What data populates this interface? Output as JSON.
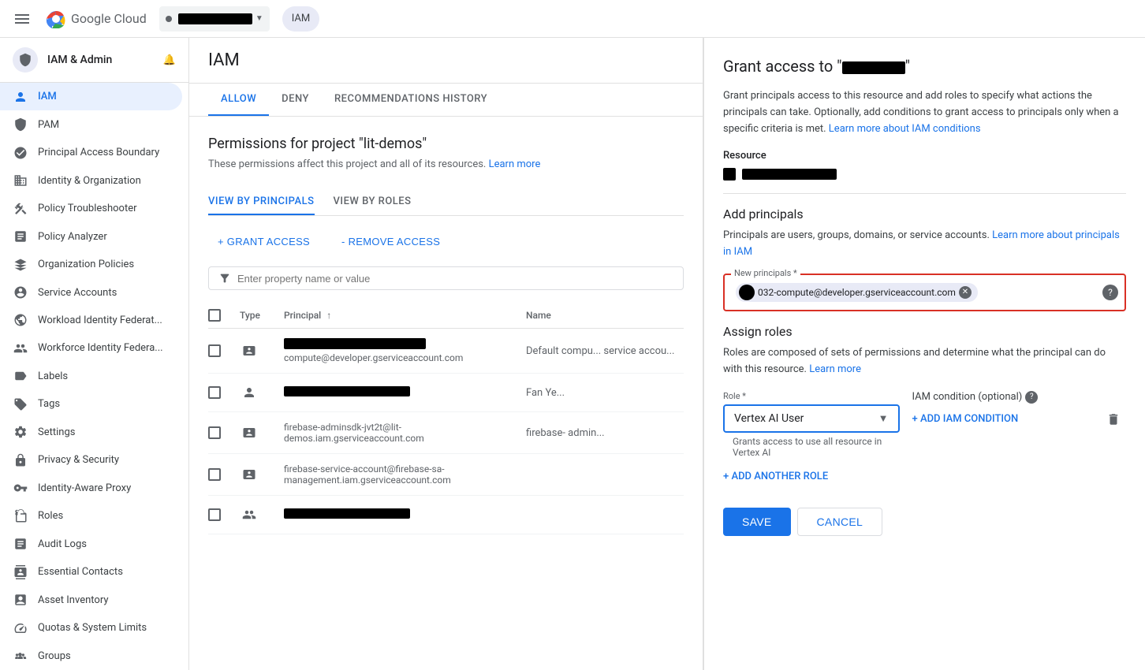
{
  "topbar": {
    "menu_icon": "menu",
    "google_text": "Google",
    "cloud_text": "Cloud",
    "project_text": "██████████",
    "iam_chip": "IAM"
  },
  "sidebar": {
    "header_title": "IAM & Admin",
    "items": [
      {
        "id": "iam",
        "label": "IAM",
        "icon": "person",
        "active": true
      },
      {
        "id": "pam",
        "label": "PAM",
        "icon": "shield"
      },
      {
        "id": "pab",
        "label": "Principal Access Boundary",
        "icon": "security"
      },
      {
        "id": "identity-org",
        "label": "Identity & Organization",
        "icon": "business"
      },
      {
        "id": "policy-troubleshooter",
        "label": "Policy Troubleshooter",
        "icon": "build"
      },
      {
        "id": "policy-analyzer",
        "label": "Policy Analyzer",
        "icon": "policy"
      },
      {
        "id": "org-policies",
        "label": "Organization Policies",
        "icon": "account-balance"
      },
      {
        "id": "service-accounts",
        "label": "Service Accounts",
        "icon": "manage-accounts"
      },
      {
        "id": "workload-identity-fed",
        "label": "Workload Identity Federat...",
        "icon": "hub"
      },
      {
        "id": "workforce-identity-fed",
        "label": "Workforce Identity Federa...",
        "icon": "groups"
      },
      {
        "id": "labels",
        "label": "Labels",
        "icon": "label"
      },
      {
        "id": "tags",
        "label": "Tags",
        "icon": "tag"
      },
      {
        "id": "settings",
        "label": "Settings",
        "icon": "settings"
      },
      {
        "id": "privacy-security",
        "label": "Privacy & Security",
        "icon": "lock"
      },
      {
        "id": "identity-aware-proxy",
        "label": "Identity-Aware Proxy",
        "icon": "vpn-key"
      },
      {
        "id": "roles",
        "label": "Roles",
        "icon": "badge"
      },
      {
        "id": "audit-logs",
        "label": "Audit Logs",
        "icon": "list-alt"
      },
      {
        "id": "essential-contacts",
        "label": "Essential Contacts",
        "icon": "contacts"
      },
      {
        "id": "asset-inventory",
        "label": "Asset Inventory",
        "icon": "inventory"
      },
      {
        "id": "quotas-system-limits",
        "label": "Quotas & System Limits",
        "icon": "speed"
      },
      {
        "id": "groups",
        "label": "Groups",
        "icon": "group"
      }
    ]
  },
  "main": {
    "title": "IAM",
    "tabs": [
      {
        "id": "allow",
        "label": "ALLOW",
        "active": true
      },
      {
        "id": "deny",
        "label": "DENY"
      },
      {
        "id": "recommendations-history",
        "label": "RECOMMENDATIONS HISTORY"
      }
    ],
    "permissions_title": "Permissions for project \"lit-demos\"",
    "permissions_subtitle": "These permissions affect this project and all of its resources.",
    "learn_more": "Learn more",
    "view_tabs": [
      {
        "id": "by-principals",
        "label": "VIEW BY PRINCIPALS",
        "active": true
      },
      {
        "id": "by-roles",
        "label": "VIEW BY ROLES"
      }
    ],
    "grant_access": "+ GRANT ACCESS",
    "remove_access": "- REMOVE ACCESS",
    "filter_placeholder": "Enter property name or value",
    "table": {
      "headers": [
        "",
        "Type",
        "Principal ↑",
        "Name"
      ],
      "rows": [
        {
          "type": "service-account",
          "principal_redacted": true,
          "email": "compute@developer.gserviceaccount.com",
          "name": "Default compu... service accou..."
        },
        {
          "type": "person",
          "principal_redacted": true,
          "email": "",
          "name": "Fan Ye..."
        },
        {
          "type": "service-account",
          "principal_redacted": false,
          "email": "firebase-adminsdk-jvt2t@lit-demos.iam.gserviceaccount.com",
          "name": "firebase- admin..."
        },
        {
          "type": "service-account",
          "principal_redacted": false,
          "email": "firebase-service-account@firebase-sa-management.iam.gserviceaccount.com",
          "name": ""
        },
        {
          "type": "group",
          "principal_redacted": true,
          "email": "",
          "name": ""
        }
      ]
    }
  },
  "panel": {
    "title": "Grant access to \"██████████\"",
    "description": "Grant principals access to this resource and add roles to specify what actions the principals can take. Optionally, add conditions to grant access to principals only when a specific criteria is met.",
    "learn_more_conditions": "Learn more about IAM conditions",
    "resource_label": "Resource",
    "resource_name_redacted": true,
    "add_principals_title": "Add principals",
    "add_principals_desc": "Principals are users, groups, domains, or service accounts.",
    "learn_more_principals": "Learn more about principals in IAM",
    "new_principals_label": "New principals *",
    "principal_chip_text": "032-compute@developer.gserviceaccount.com",
    "assign_roles_title": "Assign roles",
    "assign_roles_desc": "Roles are composed of sets of permissions and determine what the principal can do with this resource.",
    "learn_more_roles": "Learn more",
    "role_label": "Role *",
    "role_value": "Vertex AI User",
    "role_desc": "Grants access to use all resource in Vertex AI",
    "iam_condition_label": "IAM condition (optional)",
    "add_iam_condition": "+ ADD IAM CONDITION",
    "add_another_role": "+ ADD ANOTHER ROLE",
    "save_label": "SAVE",
    "cancel_label": "CANCEL"
  }
}
